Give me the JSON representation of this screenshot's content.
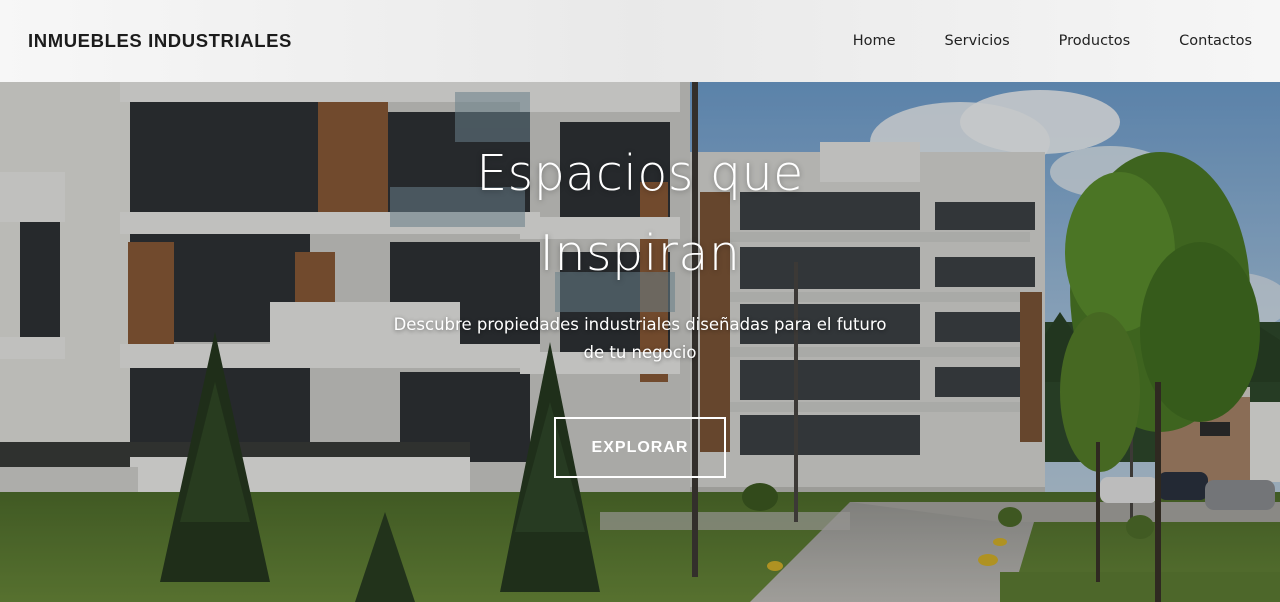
{
  "navbar": {
    "brand": "INMUEBLES INDUSTRIALES",
    "links": [
      {
        "label": "Home"
      },
      {
        "label": "Servicios"
      },
      {
        "label": "Productos"
      },
      {
        "label": "Contactos"
      }
    ]
  },
  "hero": {
    "title_line1": "Espacios que",
    "title_line2": "Inspiran",
    "subtitle_line1": "Descubre propiedades industriales diseñadas para el futuro",
    "subtitle_line2": "de tu negocio",
    "cta_label": "EXPLORAR"
  }
}
